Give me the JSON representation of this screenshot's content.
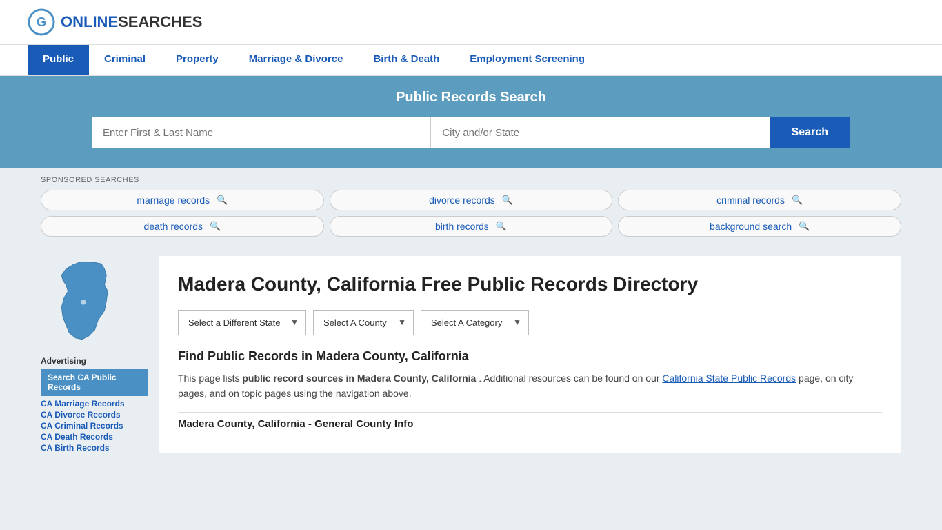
{
  "site": {
    "logo_text_regular": "ONLINE",
    "logo_text_bold": "SEARCHES"
  },
  "nav": {
    "items": [
      {
        "label": "Public",
        "active": true
      },
      {
        "label": "Criminal",
        "active": false
      },
      {
        "label": "Property",
        "active": false
      },
      {
        "label": "Marriage & Divorce",
        "active": false
      },
      {
        "label": "Birth & Death",
        "active": false
      },
      {
        "label": "Employment Screening",
        "active": false
      }
    ]
  },
  "search_banner": {
    "title": "Public Records Search",
    "name_placeholder": "Enter First & Last Name",
    "location_placeholder": "City and/or State",
    "button_label": "Search"
  },
  "sponsored": {
    "label": "SPONSORED SEARCHES",
    "pills": [
      {
        "label": "marriage records"
      },
      {
        "label": "divorce records"
      },
      {
        "label": "criminal records"
      },
      {
        "label": "death records"
      },
      {
        "label": "birth records"
      },
      {
        "label": "background search"
      }
    ]
  },
  "sidebar": {
    "ad_label": "Advertising",
    "ad_highlight": "Search CA Public Records",
    "ad_links": [
      "CA Marriage Records",
      "CA Divorce Records",
      "CA Criminal Records",
      "CA Death Records",
      "CA Birth Records"
    ]
  },
  "main": {
    "page_title": "Madera County, California Free Public Records Directory",
    "dropdowns": {
      "state_label": "Select a Different State",
      "county_label": "Select A County",
      "category_label": "Select A Category"
    },
    "section_title": "Find Public Records in Madera County, California",
    "section_text_1": "This page lists",
    "section_bold": "public record sources in Madera County, California",
    "section_text_2": ". Additional resources can be found on our",
    "section_link": "California State Public Records",
    "section_text_3": "page, on city pages, and on topic pages using the navigation above.",
    "general_info_heading": "Madera County, California - General County Info"
  }
}
